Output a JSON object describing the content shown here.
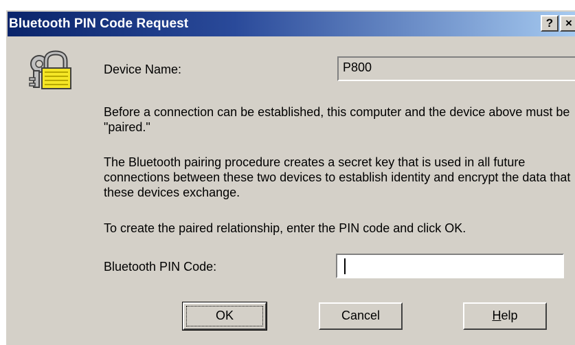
{
  "window": {
    "title": "Bluetooth PIN Code Request",
    "help_glyph": "?",
    "close_glyph": "×"
  },
  "device": {
    "label": "Device Name:",
    "value": "P800"
  },
  "paragraphs": [
    "Before a connection can be established, this computer and the device above must be \"paired.\"",
    "The Bluetooth pairing procedure creates a secret key that is used in all future connections between these two devices to establish identity and encrypt the data that these devices exchange.",
    "To create the paired relationship, enter the PIN code and click OK."
  ],
  "pin": {
    "label": "Bluetooth PIN Code:",
    "value": ""
  },
  "buttons": {
    "ok": "OK",
    "cancel": "Cancel",
    "help_first": "H",
    "help_rest": "elp"
  },
  "icons": {
    "dialog_icon": "keys-padlock-icon"
  },
  "colors": {
    "titlebar_start": "#0a246a",
    "titlebar_end": "#a6caf0",
    "dialog_face": "#d4d0c8"
  }
}
